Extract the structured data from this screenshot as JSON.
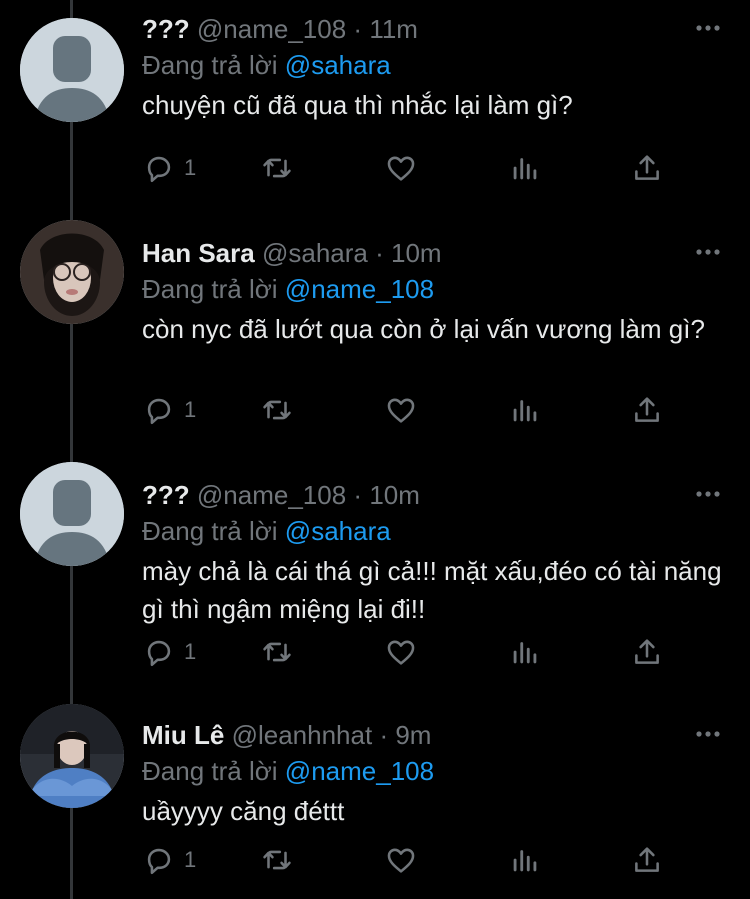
{
  "tweets": [
    {
      "name": "???",
      "handle": "@name_108",
      "dot": "·",
      "time": "11m",
      "reply_prefix": "Đang trả lời",
      "reply_to": "@sahara",
      "text": "chuyện cũ đã qua thì nhắc lại làm gì?",
      "reply_count": "1",
      "avatar": "default-avatar"
    },
    {
      "name": "Han Sara",
      "handle": "@sahara",
      "dot": "·",
      "time": "10m",
      "reply_prefix": "Đang trả lời",
      "reply_to": "@name_108",
      "text": "còn nyc đã lướt qua còn ở lại vấn vương làm gì?",
      "reply_count": "1",
      "avatar": "photo-avatar"
    },
    {
      "name": "???",
      "handle": "@name_108",
      "dot": "·",
      "time": "10m",
      "reply_prefix": "Đang trả lời",
      "reply_to": "@sahara",
      "text": "mày chả là cái thá gì cả!!! mặt xấu,đéo có tài năng gì thì ngậm miệng lại đi!!",
      "reply_count": "1",
      "avatar": "default-avatar"
    },
    {
      "name": "Miu Lê",
      "handle": "@leanhnhat",
      "dot": "·",
      "time": "9m",
      "reply_prefix": "Đang trả lời",
      "reply_to": "@name_108",
      "text": "uầyyyy căng đéttt",
      "reply_count": "1",
      "avatar": "photo-avatar"
    }
  ],
  "colors": {
    "background": "#000000",
    "text": "#e7e9ea",
    "secondary": "#71767b",
    "link": "#1d9bf0"
  }
}
